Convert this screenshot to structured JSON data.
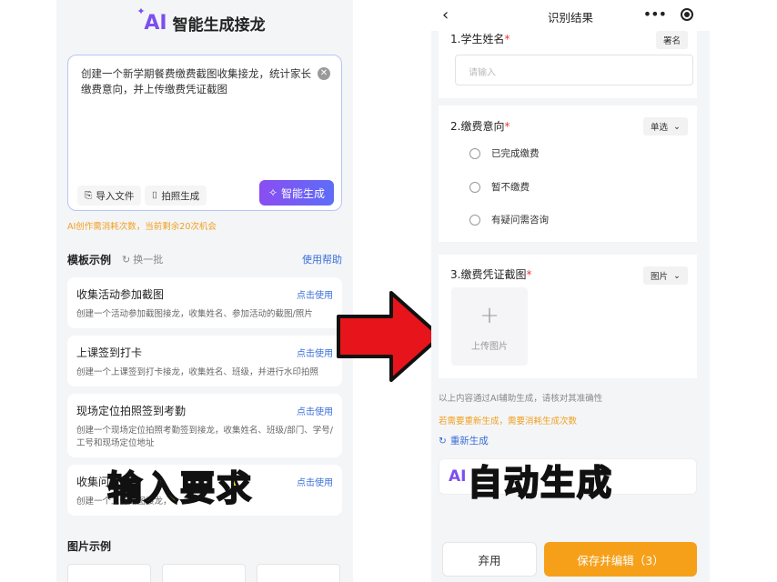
{
  "left": {
    "logo_text": "AI",
    "title": "智能生成接龙",
    "prompt_text": "创建一个新学期餐费缴费截图收集接龙，统计家长缴费意向，并上传缴费凭证截图",
    "import_file": "导入文件",
    "photo_gen": "拍照生成",
    "generate_btn": "智能生成",
    "quota_note": "AI创作需消耗次数，当前剩余20次机会",
    "templates_title": "模板示例",
    "refresh": "换一批",
    "help": "使用帮助",
    "templates": [
      {
        "title": "收集活动参加截图",
        "use": "点击使用",
        "desc": "创建一个活动参加截图接龙，收集姓名、参加活动的截图/照片"
      },
      {
        "title": "上课签到打卡",
        "use": "点击使用",
        "desc": "创建一个上课签到打卡接龙，收集姓名、班级，并进行水印拍照"
      },
      {
        "title": "现场定位拍照签到考勤",
        "use": "点击使用",
        "desc": "创建一个现场定位拍照考勤签到接龙，收集姓名、班级/部门、学号/工号和现场定位地址"
      },
      {
        "title": "收集问",
        "use": "点击使用",
        "desc": "创建一个上传截图接龙，"
      }
    ],
    "images_title": "图片示例",
    "overlay": "输入要求"
  },
  "right": {
    "nav_title": "识别结果",
    "q1": {
      "title": "1.学生姓名",
      "tag": "署名",
      "placeholder": "请输入"
    },
    "q2": {
      "title": "2.缴费意向",
      "tag": "单选",
      "options": [
        "已完成缴费",
        "暂不缴费",
        "有疑问需咨询"
      ]
    },
    "q3": {
      "title": "3.缴费凭证截图",
      "tag": "图片",
      "upload_label": "上传图片"
    },
    "note1": "以上内容通过AI辅助生成，请核对其准确性",
    "note2": "若需要重新生成，需要消耗生成次数",
    "regen": "重新生成",
    "ai_text": "AI",
    "discard": "弃用",
    "save": "保存并编辑（3）",
    "overlay": "自动生成"
  },
  "colors": {
    "accent": "#7b4ff0",
    "orange": "#f6a01a",
    "link": "#3a6fd8",
    "arrow": "#e8141b"
  }
}
